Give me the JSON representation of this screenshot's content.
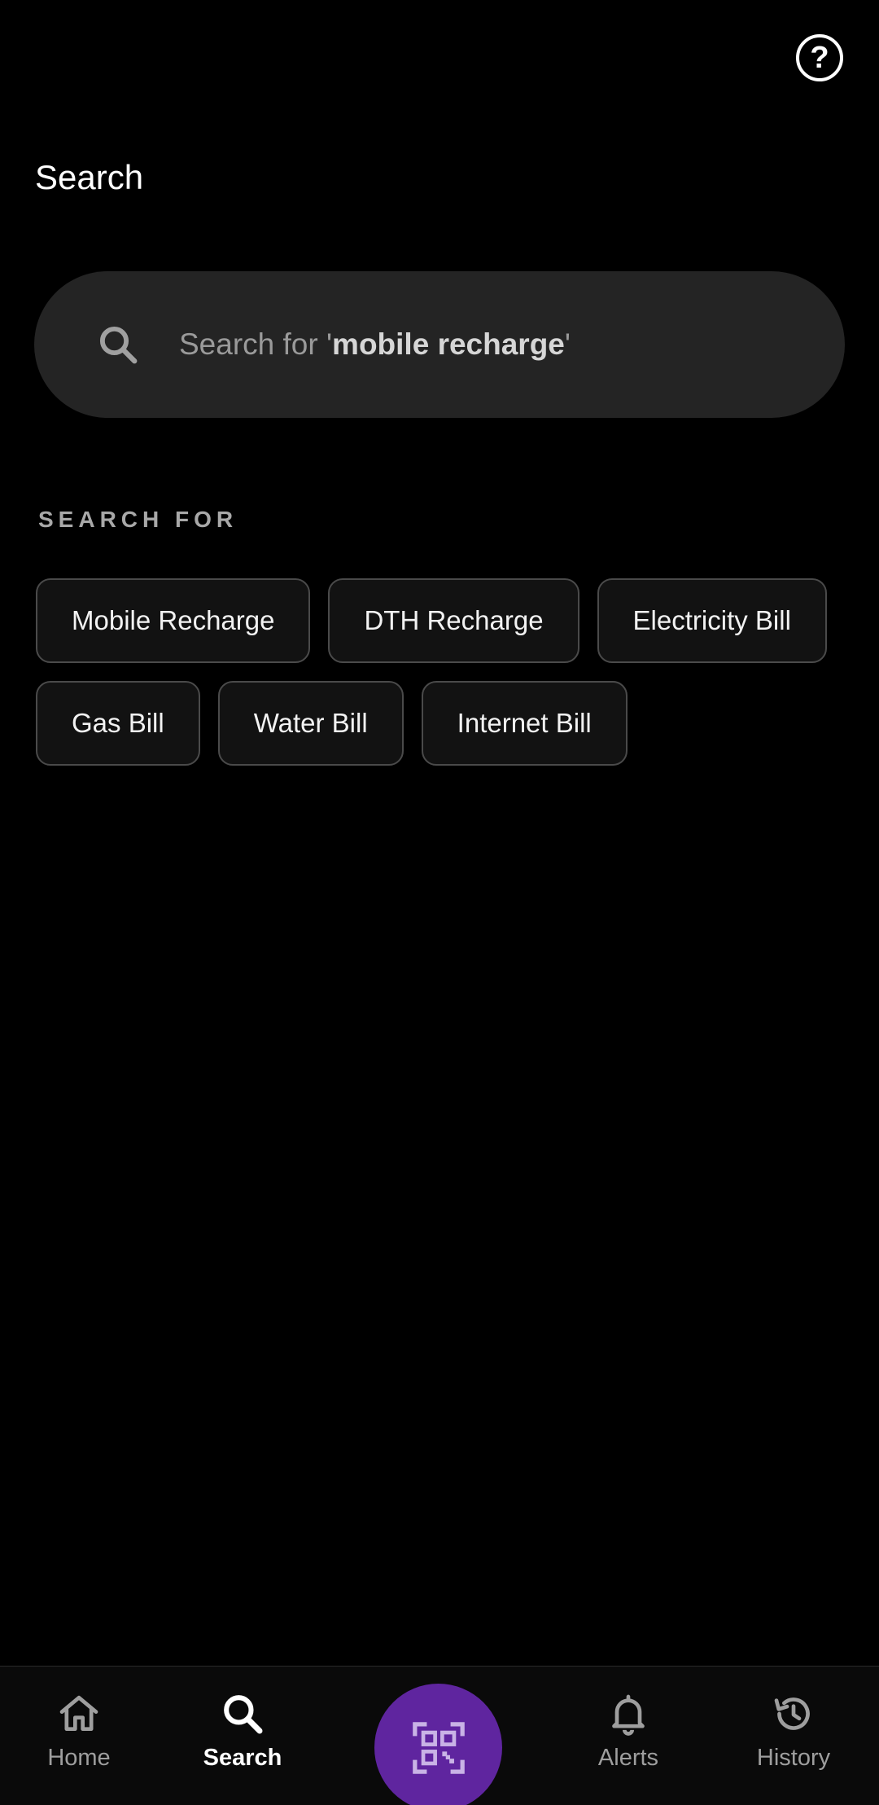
{
  "header": {
    "title": "Search",
    "help_icon": "question-circle-icon",
    "help_label": "?"
  },
  "search": {
    "placeholder_prefix": "Search for '",
    "placeholder_highlight": "mobile recharge",
    "placeholder_suffix": "'",
    "icon": "search-icon"
  },
  "suggestions": {
    "label": "SEARCH FOR",
    "rows": [
      [
        "Mobile Recharge",
        "DTH Recharge",
        "Electricity Bill"
      ],
      [
        "Gas Bill",
        "Water Bill",
        "Internet Bill"
      ]
    ]
  },
  "bottom_nav": {
    "items": [
      {
        "label": "Home",
        "icon": "home-icon",
        "active": false
      },
      {
        "label": "Search",
        "icon": "search-icon",
        "active": true
      },
      {
        "label": "Alerts",
        "icon": "bell-icon",
        "active": false
      },
      {
        "label": "History",
        "icon": "history-icon",
        "active": false
      }
    ],
    "scan_icon": "qr-scan-icon"
  },
  "colors": {
    "background": "#000000",
    "search_box": "#242424",
    "chip_border": "#4a4a4a",
    "accent": "#5f259f"
  }
}
